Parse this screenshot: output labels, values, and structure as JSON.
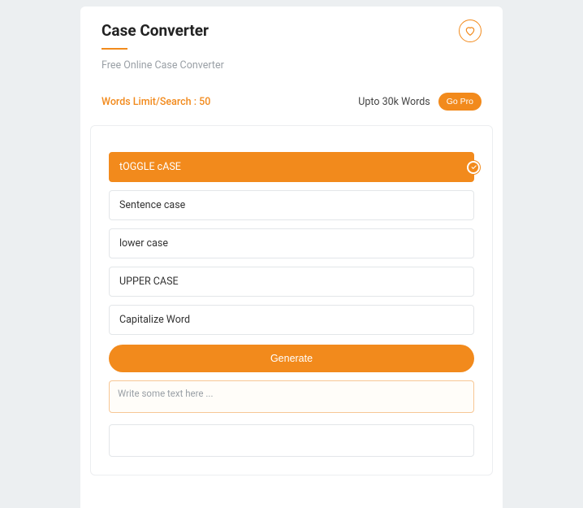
{
  "header": {
    "title": "Case Converter",
    "subtitle": "Free Online Case Converter"
  },
  "limits": {
    "left": "Words Limit/Search : 50",
    "upto": "Upto 30k Words",
    "gopro": "Go Pro"
  },
  "options": [
    {
      "label": "tOGGLE cASE",
      "selected": true
    },
    {
      "label": "Sentence case",
      "selected": false
    },
    {
      "label": "lower case",
      "selected": false
    },
    {
      "label": "UPPER CASE",
      "selected": false
    },
    {
      "label": "Capitalize Word",
      "selected": false
    }
  ],
  "generate_label": "Generate",
  "input_placeholder": "Write some text here ...",
  "colors": {
    "accent": "#f28a1c"
  }
}
